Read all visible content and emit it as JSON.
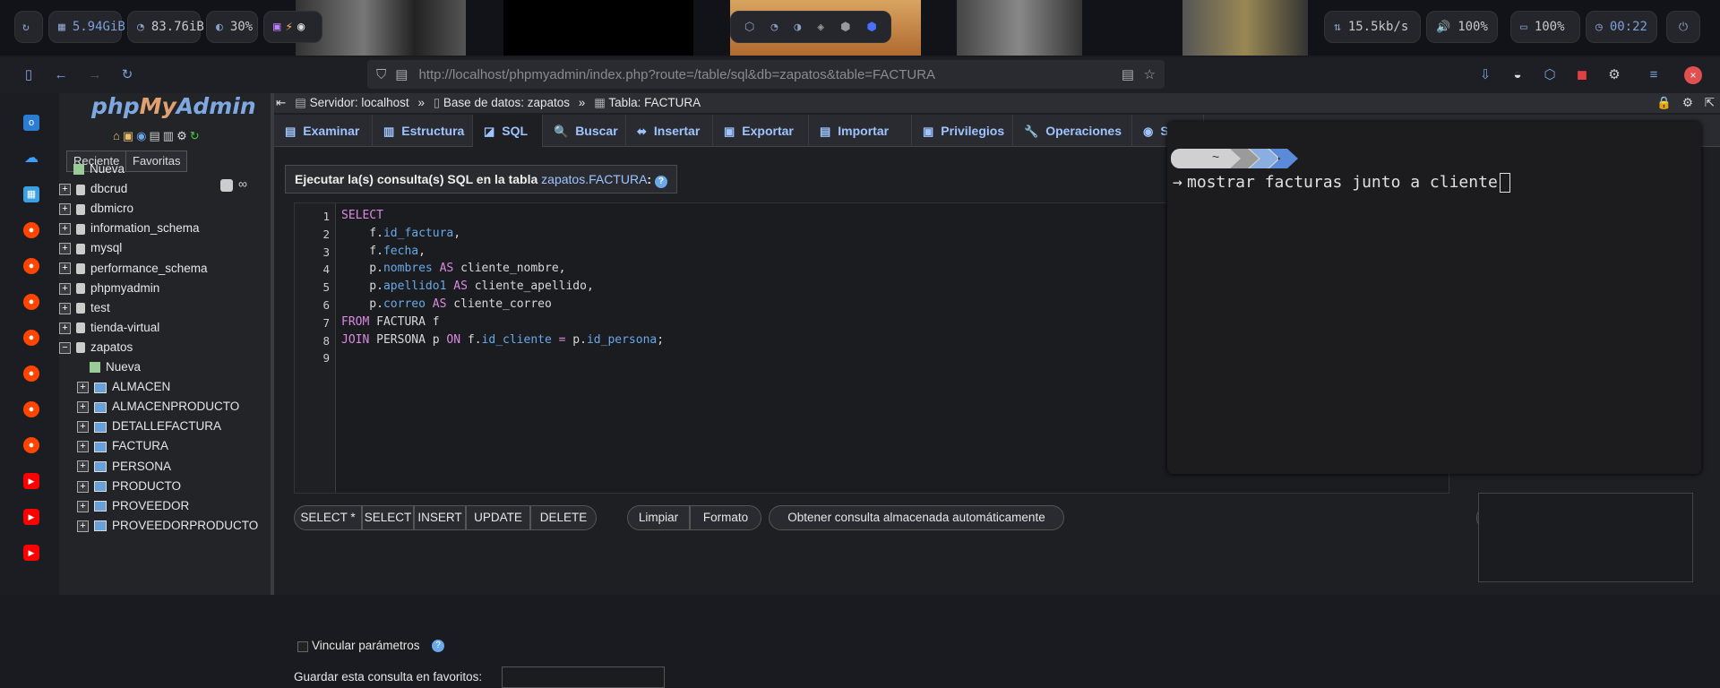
{
  "statusbar": {
    "memory": "5.94GiB",
    "disk": "83.76iB",
    "cpu": "30%",
    "network": "15.5kb/s",
    "volume": "100%",
    "battery": "100%",
    "clock": "00:22"
  },
  "browser": {
    "url_host": "http://localhost",
    "url_path": "/phpmyadmin/index.php?route=/table/sql&db=zapatos&table=FACTURA"
  },
  "sidebar": {
    "logo_php": "php",
    "logo_my": "My",
    "logo_admin": "Admin",
    "recent_label": "Reciente",
    "favorites_label": "Favoritas",
    "tree": [
      {
        "label": "Nueva"
      },
      {
        "label": "dbcrud"
      },
      {
        "label": "dbmicro"
      },
      {
        "label": "information_schema"
      },
      {
        "label": "mysql"
      },
      {
        "label": "performance_schema"
      },
      {
        "label": "phpmyadmin"
      },
      {
        "label": "test"
      },
      {
        "label": "tienda-virtual"
      },
      {
        "label": "zapatos"
      }
    ],
    "zapatos_children": [
      {
        "label": "Nueva"
      },
      {
        "label": "ALMACEN"
      },
      {
        "label": "ALMACENPRODUCTO"
      },
      {
        "label": "DETALLEFACTURA"
      },
      {
        "label": "FACTURA"
      },
      {
        "label": "PERSONA"
      },
      {
        "label": "PRODUCTO"
      },
      {
        "label": "PROVEEDOR"
      },
      {
        "label": "PROVEEDORPRODUCTO"
      }
    ]
  },
  "breadcrumb": {
    "server": "Servidor: localhost",
    "database": "Base de datos: zapatos",
    "table": "Tabla: FACTURA"
  },
  "tabs": [
    {
      "label": "Examinar"
    },
    {
      "label": "Estructura"
    },
    {
      "label": "SQL"
    },
    {
      "label": "Buscar"
    },
    {
      "label": "Insertar"
    },
    {
      "label": "Exportar"
    },
    {
      "label": "Importar"
    },
    {
      "label": "Privilegios"
    },
    {
      "label": "Operaciones"
    },
    {
      "label": "S"
    }
  ],
  "sql_panel": {
    "legend": "Ejecutar la(s) consulta(s) SQL en la tabla",
    "table_name": "zapatos.FACTURA",
    "line_numbers": [
      "1",
      "2",
      "3",
      "4",
      "5",
      "6",
      "7",
      "8",
      "9"
    ]
  },
  "query_buttons": [
    "SELECT *",
    "SELECT",
    "INSERT",
    "UPDATE",
    "DELETE",
    "Limpiar",
    "Formato",
    "Obtener consulta almacenada automáticamente",
    "<<"
  ],
  "bind_params_label": "Vincular parámetros",
  "bookmark_label": "Guardar esta consulta en favoritos:",
  "terminal": {
    "tilde": "~",
    "command": "mostrar facturas junto a cliente"
  }
}
